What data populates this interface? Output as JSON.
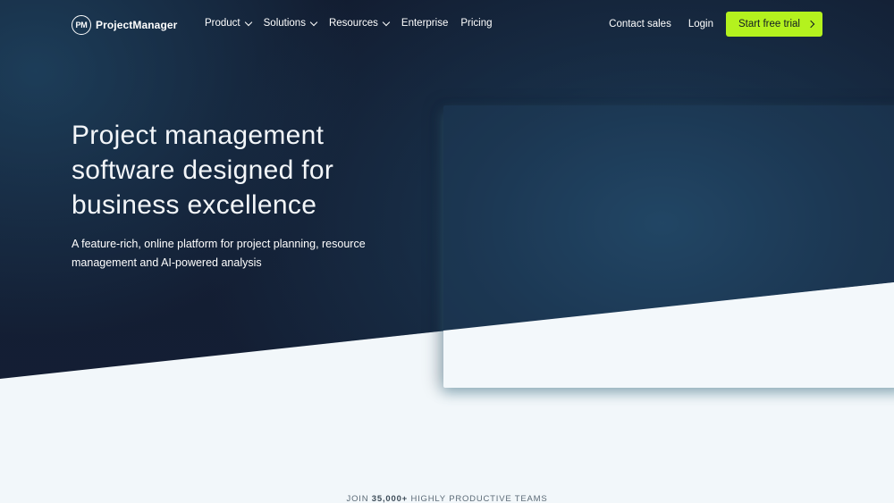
{
  "nav": {
    "logo_mark": "PM",
    "logo_text": "ProjectManager",
    "menu": [
      {
        "label": "Product",
        "has_dropdown": true
      },
      {
        "label": "Solutions",
        "has_dropdown": true
      },
      {
        "label": "Resources",
        "has_dropdown": true
      },
      {
        "label": "Enterprise",
        "has_dropdown": false
      },
      {
        "label": "Pricing",
        "has_dropdown": false
      }
    ],
    "contact_label": "Contact sales",
    "login_label": "Login",
    "cta_label": "Start free trial"
  },
  "hero": {
    "headline": "Project management software designed for business excellence",
    "subhead": "A feature-rich, online platform for project planning, resource management and AI-powered analysis"
  },
  "social_proof": {
    "prefix": "JOIN ",
    "count": "35,000+",
    "suffix": " HIGHLY PRODUCTIVE TEAMS"
  },
  "colors": {
    "hero_dark": "#131d31",
    "cta_green": "#b4f21e",
    "page_light": "#f2f7fa"
  },
  "icons": {
    "dropdown": "chevron-down-icon",
    "cta_arrow": "chevron-right-icon"
  }
}
